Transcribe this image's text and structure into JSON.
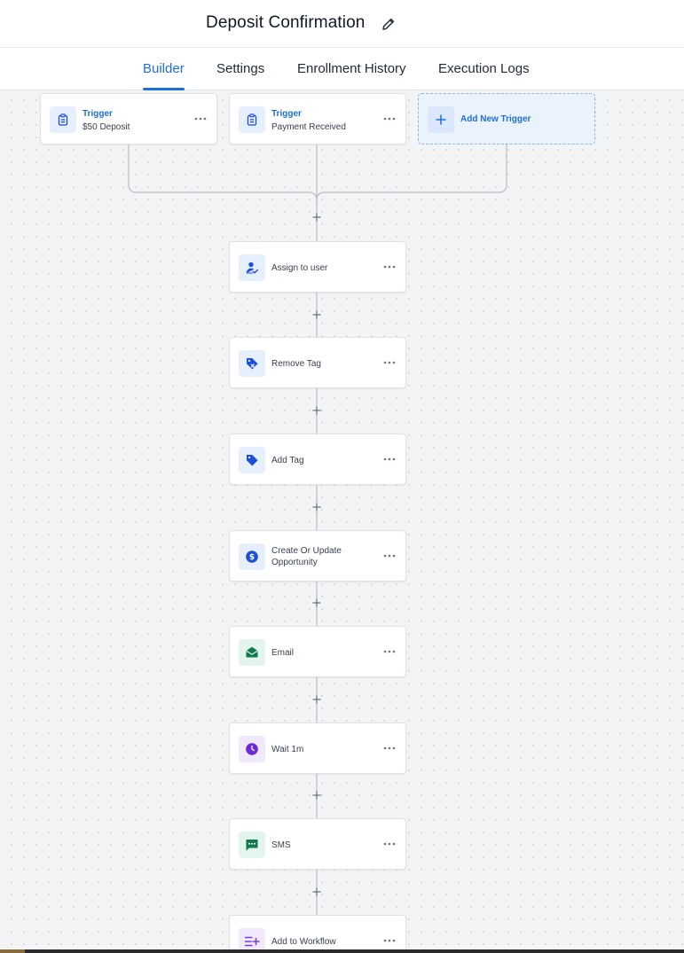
{
  "header": {
    "title": "Deposit Confirmation"
  },
  "tabs": [
    {
      "label": "Builder",
      "active": true
    },
    {
      "label": "Settings",
      "active": false
    },
    {
      "label": "Enrollment History",
      "active": false
    },
    {
      "label": "Execution Logs",
      "active": false
    }
  ],
  "triggers": [
    {
      "type_label": "Trigger",
      "name": "$50 Deposit",
      "icon": "clipboard-icon"
    },
    {
      "type_label": "Trigger",
      "name": "Payment Received",
      "icon": "clipboard-icon"
    }
  ],
  "add_trigger": {
    "label": "Add New Trigger",
    "icon": "plus-icon"
  },
  "actions": [
    {
      "label": "Assign to user",
      "icon": "assign-user-icon",
      "color": "#1d4ed8"
    },
    {
      "label": "Remove Tag",
      "icon": "remove-tag-icon",
      "color": "#1d4ed8"
    },
    {
      "label": "Add Tag",
      "icon": "tag-icon",
      "color": "#1d4ed8"
    },
    {
      "label": "Create Or Update Opportunity",
      "icon": "dollar-icon",
      "color": "#1d4ed8"
    },
    {
      "label": "Email",
      "icon": "envelope-icon",
      "color": "#0f7a4f"
    },
    {
      "label": "Wait 1m",
      "icon": "clock-icon",
      "color": "#6d28d9"
    },
    {
      "label": "SMS",
      "icon": "chat-icon",
      "color": "#0f7a4f"
    },
    {
      "label": "Add to Workflow",
      "icon": "add-workflow-icon",
      "color": "#7c3aed"
    }
  ],
  "colors": {
    "accent": "#1d6fd8",
    "canvas": "#f3f4f6",
    "wire": "#b8bcc4"
  }
}
